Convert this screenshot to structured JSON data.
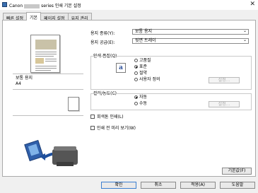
{
  "window": {
    "title_prefix": "Canon",
    "title_suffix": "series 인쇄 기본 설정",
    "close_glyph": "✕"
  },
  "tabs": [
    {
      "label": "빠른 설정"
    },
    {
      "label": "기본"
    },
    {
      "label": "페이지 설정"
    },
    {
      "label": "유지 관리"
    }
  ],
  "active_tab_index": 1,
  "preview": {
    "media_type": "보통 용지",
    "paper_size": "A4"
  },
  "media_type": {
    "label": "용지 종류(Y):",
    "value": "보통 용지"
  },
  "paper_source": {
    "label": "용지 공급(E):",
    "value": "뒷면 트레이"
  },
  "print_quality": {
    "label": "인쇄 품질(Q)",
    "options": [
      {
        "label": "고품질",
        "checked": false
      },
      {
        "label": "표준",
        "checked": true
      },
      {
        "label": "절약",
        "checked": false
      },
      {
        "label": "사용자 정의",
        "checked": false
      }
    ],
    "settings_button": "설정..."
  },
  "color_intensity": {
    "label": "컬러/농도(C)",
    "options": [
      {
        "label": "자동",
        "checked": true
      },
      {
        "label": "수동",
        "checked": false
      }
    ],
    "settings_button": "설정..."
  },
  "grayscale": {
    "label": "회색톤 인쇄(L)",
    "checked": false
  },
  "preview_before_print": {
    "label": "인쇄 전 미리 보기(W)",
    "checked": false
  },
  "buttons": {
    "defaults": "기본값(F)",
    "ok": "확인",
    "cancel": "취소",
    "apply": "적용(A)",
    "help": "도움말"
  }
}
